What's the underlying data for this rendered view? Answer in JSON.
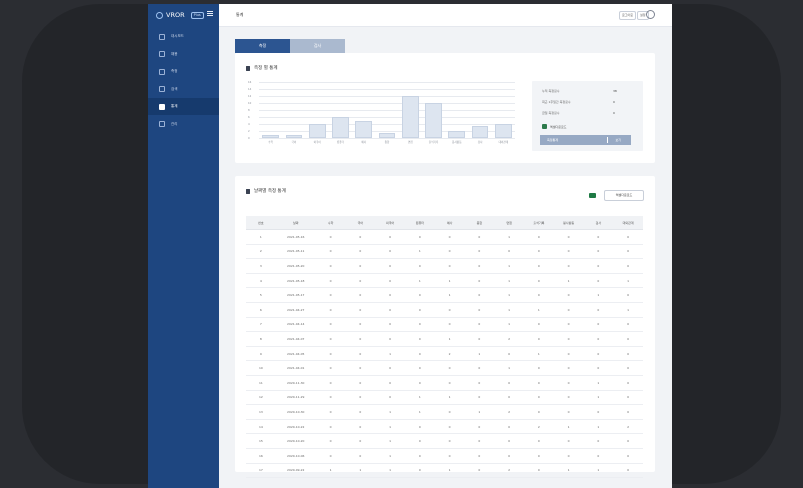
{
  "app": {
    "brand": "VROR",
    "brand_tag": "Plus"
  },
  "sidebar": {
    "items": [
      {
        "label": "대시보드",
        "icon": "home-icon",
        "active": false
      },
      {
        "label": "채용",
        "icon": "monitor-icon",
        "active": false
      },
      {
        "label": "측정",
        "icon": "target-icon",
        "active": false
      },
      {
        "label": "검색",
        "icon": "search-icon",
        "active": false
      },
      {
        "label": "통계",
        "icon": "document-icon",
        "active": true
      },
      {
        "label": "관리",
        "icon": "calendar-icon",
        "active": false
      }
    ]
  },
  "topbar": {
    "title": "통계",
    "btn1": "로그아웃",
    "btn2": "설정"
  },
  "tabs": [
    {
      "label": "측정",
      "active": true
    },
    {
      "label": "검사",
      "active": false
    }
  ],
  "card1": {
    "title": "측정 별 통계",
    "info": {
      "rows": [
        {
          "label": "누적 측정횟수",
          "value": "38"
        },
        {
          "label": "최근 1주일간 측정횟수",
          "value": "0"
        },
        {
          "label": "금일 측정횟수",
          "value": "0"
        }
      ],
      "checkbox_label": "엑셀다운로드",
      "button_label": "측정통계",
      "button_sub": "보기"
    }
  },
  "chart_data": {
    "type": "bar",
    "categories": [
      "수학",
      "국어",
      "외국어",
      "컴퓨터",
      "예사",
      "종합",
      "면접",
      "출석기록",
      "봉사활동",
      "검사",
      "대외관계"
    ],
    "values": [
      1,
      1,
      4,
      6,
      5,
      1.5,
      12,
      10,
      2,
      3.5,
      4
    ],
    "ylim": [
      0,
      16
    ],
    "yticks": [
      "16",
      "14",
      "12",
      "10",
      "8",
      "6",
      "4",
      "2",
      "0"
    ]
  },
  "card2": {
    "title": "날짜별 측정 통계",
    "download_label": "엑셀다운로드",
    "columns": [
      "번호",
      "날짜",
      "수학",
      "국어",
      "외국어",
      "컴퓨터",
      "예사",
      "종합",
      "면접",
      "출석기록",
      "봉사활동",
      "검사",
      "대외관계"
    ],
    "rows": [
      [
        "1",
        "2021-05-16",
        "0",
        "0",
        "0",
        "0",
        "0",
        "0",
        "1",
        "0",
        "0",
        "0",
        "0"
      ],
      [
        "2",
        "2021-05-11",
        "0",
        "0",
        "0",
        "1",
        "0",
        "0",
        "0",
        "0",
        "0",
        "0",
        "0"
      ],
      [
        "3",
        "2021-05-20",
        "0",
        "0",
        "0",
        "0",
        "0",
        "0",
        "1",
        "0",
        "0",
        "0",
        "0"
      ],
      [
        "4",
        "2021-05-18",
        "0",
        "0",
        "0",
        "1",
        "1",
        "0",
        "1",
        "0",
        "1",
        "0",
        "1"
      ],
      [
        "5",
        "2021-05-17",
        "0",
        "0",
        "0",
        "0",
        "1",
        "0",
        "1",
        "0",
        "0",
        "1",
        "0"
      ],
      [
        "6",
        "2021-04-27",
        "0",
        "0",
        "0",
        "0",
        "0",
        "0",
        "1",
        "1",
        "0",
        "0",
        "1"
      ],
      [
        "7",
        "2021-04-14",
        "0",
        "0",
        "0",
        "0",
        "0",
        "0",
        "1",
        "0",
        "0",
        "0",
        "0"
      ],
      [
        "8",
        "2021-04-07",
        "0",
        "0",
        "0",
        "0",
        "1",
        "0",
        "2",
        "0",
        "0",
        "0",
        "0"
      ],
      [
        "9",
        "2021-04-05",
        "0",
        "0",
        "1",
        "0",
        "2",
        "1",
        "0",
        "1",
        "0",
        "0",
        "0"
      ],
      [
        "10",
        "2021-04-01",
        "0",
        "0",
        "0",
        "0",
        "0",
        "0",
        "1",
        "0",
        "0",
        "0",
        "0"
      ],
      [
        "11",
        "2020-11-30",
        "0",
        "0",
        "0",
        "0",
        "0",
        "0",
        "0",
        "0",
        "0",
        "1",
        "0"
      ],
      [
        "12",
        "2020-11-29",
        "0",
        "0",
        "0",
        "1",
        "1",
        "0",
        "0",
        "0",
        "0",
        "1",
        "0"
      ],
      [
        "13",
        "2020-10-30",
        "0",
        "0",
        "1",
        "1",
        "0",
        "1",
        "2",
        "0",
        "0",
        "0",
        "0"
      ],
      [
        "14",
        "2020-10-22",
        "0",
        "0",
        "1",
        "0",
        "0",
        "0",
        "0",
        "2",
        "1",
        "1",
        "2"
      ],
      [
        "15",
        "2020-10-20",
        "0",
        "0",
        "1",
        "0",
        "0",
        "0",
        "0",
        "0",
        "0",
        "0",
        "0"
      ],
      [
        "16",
        "2020-10-06",
        "0",
        "0",
        "1",
        "0",
        "0",
        "0",
        "0",
        "0",
        "0",
        "0",
        "0"
      ],
      [
        "17",
        "2020-09-22",
        "1",
        "1",
        "1",
        "0",
        "1",
        "0",
        "2",
        "0",
        "1",
        "1",
        "0"
      ]
    ]
  }
}
